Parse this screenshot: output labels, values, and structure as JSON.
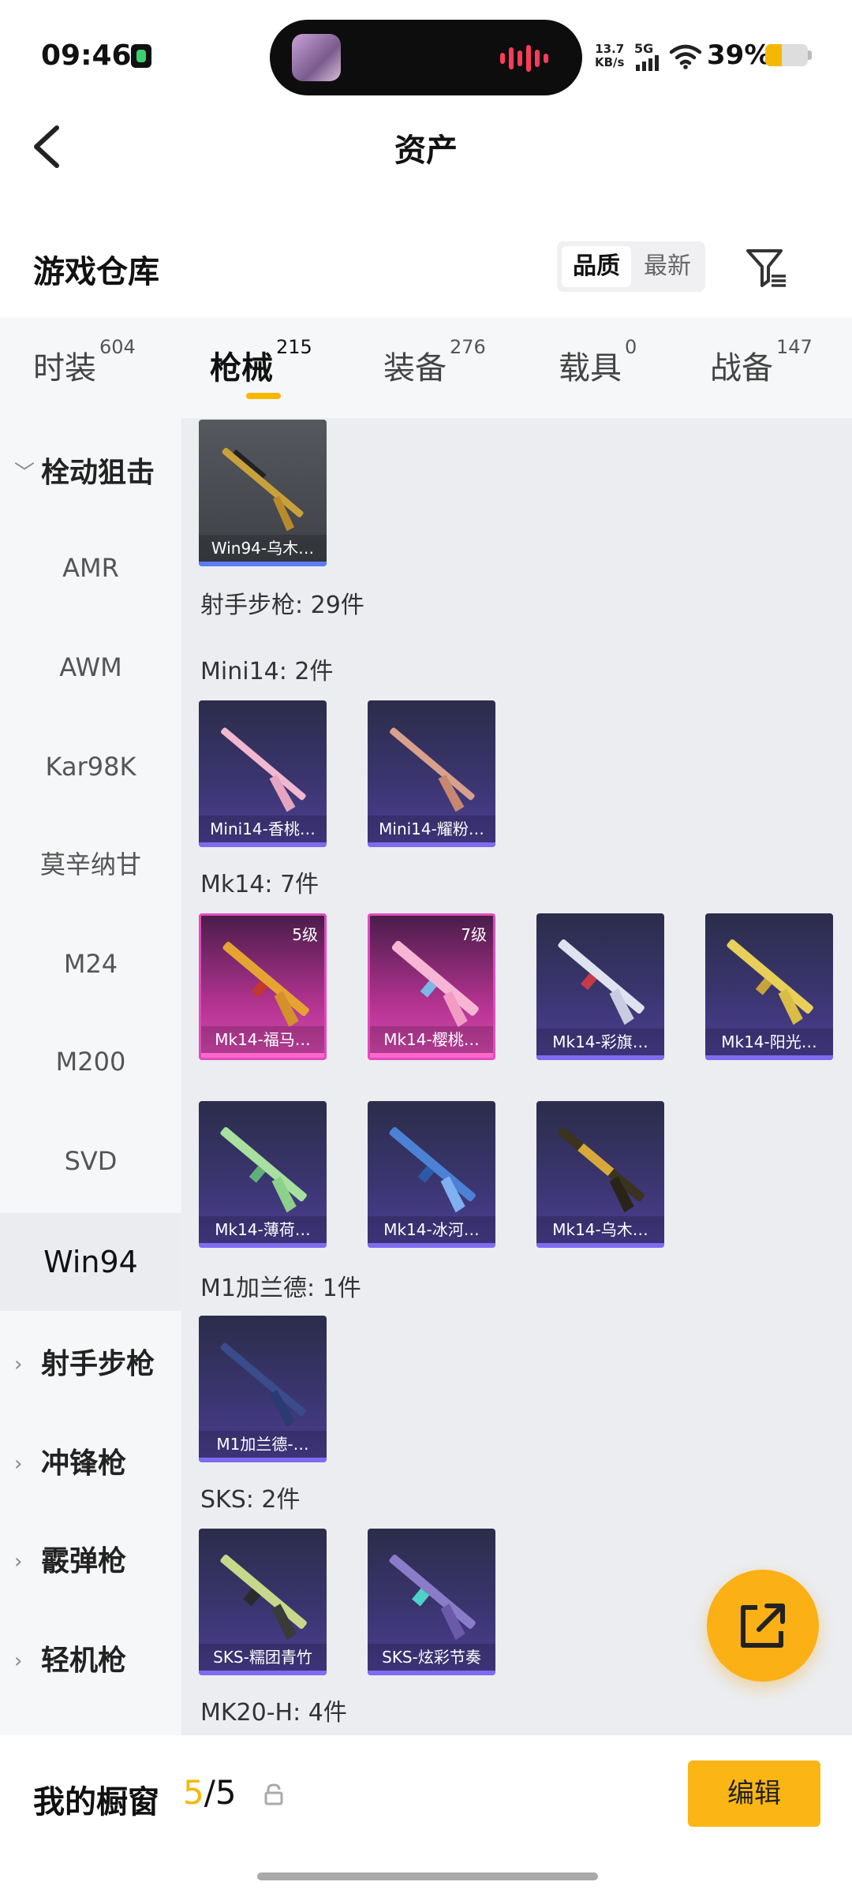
{
  "status_bar": {
    "time": "09:46",
    "speed_value": "13.7",
    "speed_unit": "KB/s",
    "network": "5G",
    "battery": "39%",
    "battery_level": 0.39
  },
  "header": {
    "title": "资产"
  },
  "warehouse": {
    "title": "游戏仓库",
    "sort": {
      "active": "品质",
      "inactive": "最新"
    }
  },
  "tabs": [
    {
      "label": "时装",
      "count": "604"
    },
    {
      "label": "枪械",
      "count": "215"
    },
    {
      "label": "装备",
      "count": "276"
    },
    {
      "label": "载具",
      "count": "0"
    },
    {
      "label": "战备",
      "count": "147"
    }
  ],
  "sidebar": {
    "sniper": "栓动狙击",
    "sniper_items": [
      "AMR",
      "AWM",
      "Kar98K",
      "莫辛纳甘",
      "M24",
      "M200",
      "SVD",
      "Win94"
    ],
    "categories": [
      "射手步枪",
      "冲锋枪",
      "霰弹枪",
      "轻机枪"
    ]
  },
  "content": {
    "sections": {
      "dmr": "射手步枪: 29件",
      "mini14": "Mini14: 2件",
      "mk14": "Mk14: 7件",
      "m1": "M1加兰德: 1件",
      "sks": "SKS: 2件",
      "mk20": "MK20-H: 4件"
    },
    "cards": {
      "win94": {
        "label": "Win94-乌木…"
      },
      "mini14_1": {
        "label": "Mini14-香桃…"
      },
      "mini14_2": {
        "label": "Mini14-耀粉…"
      },
      "mk14_1": {
        "label": "Mk14-福马…",
        "level": "5级"
      },
      "mk14_2": {
        "label": "Mk14-樱桃…",
        "level": "7级"
      },
      "mk14_3": {
        "label": "Mk14-彩旗…"
      },
      "mk14_4": {
        "label": "Mk14-阳光…"
      },
      "mk14_5": {
        "label": "Mk14-薄荷…"
      },
      "mk14_6": {
        "label": "Mk14-冰河…"
      },
      "mk14_7": {
        "label": "Mk14-乌木…"
      },
      "m1": {
        "label": "M1加兰德-…"
      },
      "sks_1": {
        "label": "SKS-糯团青竹"
      },
      "sks_2": {
        "label": "SKS-炫彩节奏"
      }
    }
  },
  "bottom": {
    "showcase_label": "我的橱窗",
    "count_current": "5",
    "count_sep_total": "/5",
    "edit_label": "编辑"
  },
  "colors": {
    "accent": "#f5b800",
    "fab": "#fbb015",
    "tab_underline": "#f5b800",
    "card_blue": "#3b3570",
    "card_pink": "#b0328e"
  },
  "icons": {
    "back": "chevron-left-icon",
    "filter": "filter-icon",
    "share": "share-external-icon",
    "lock": "lock-icon"
  }
}
